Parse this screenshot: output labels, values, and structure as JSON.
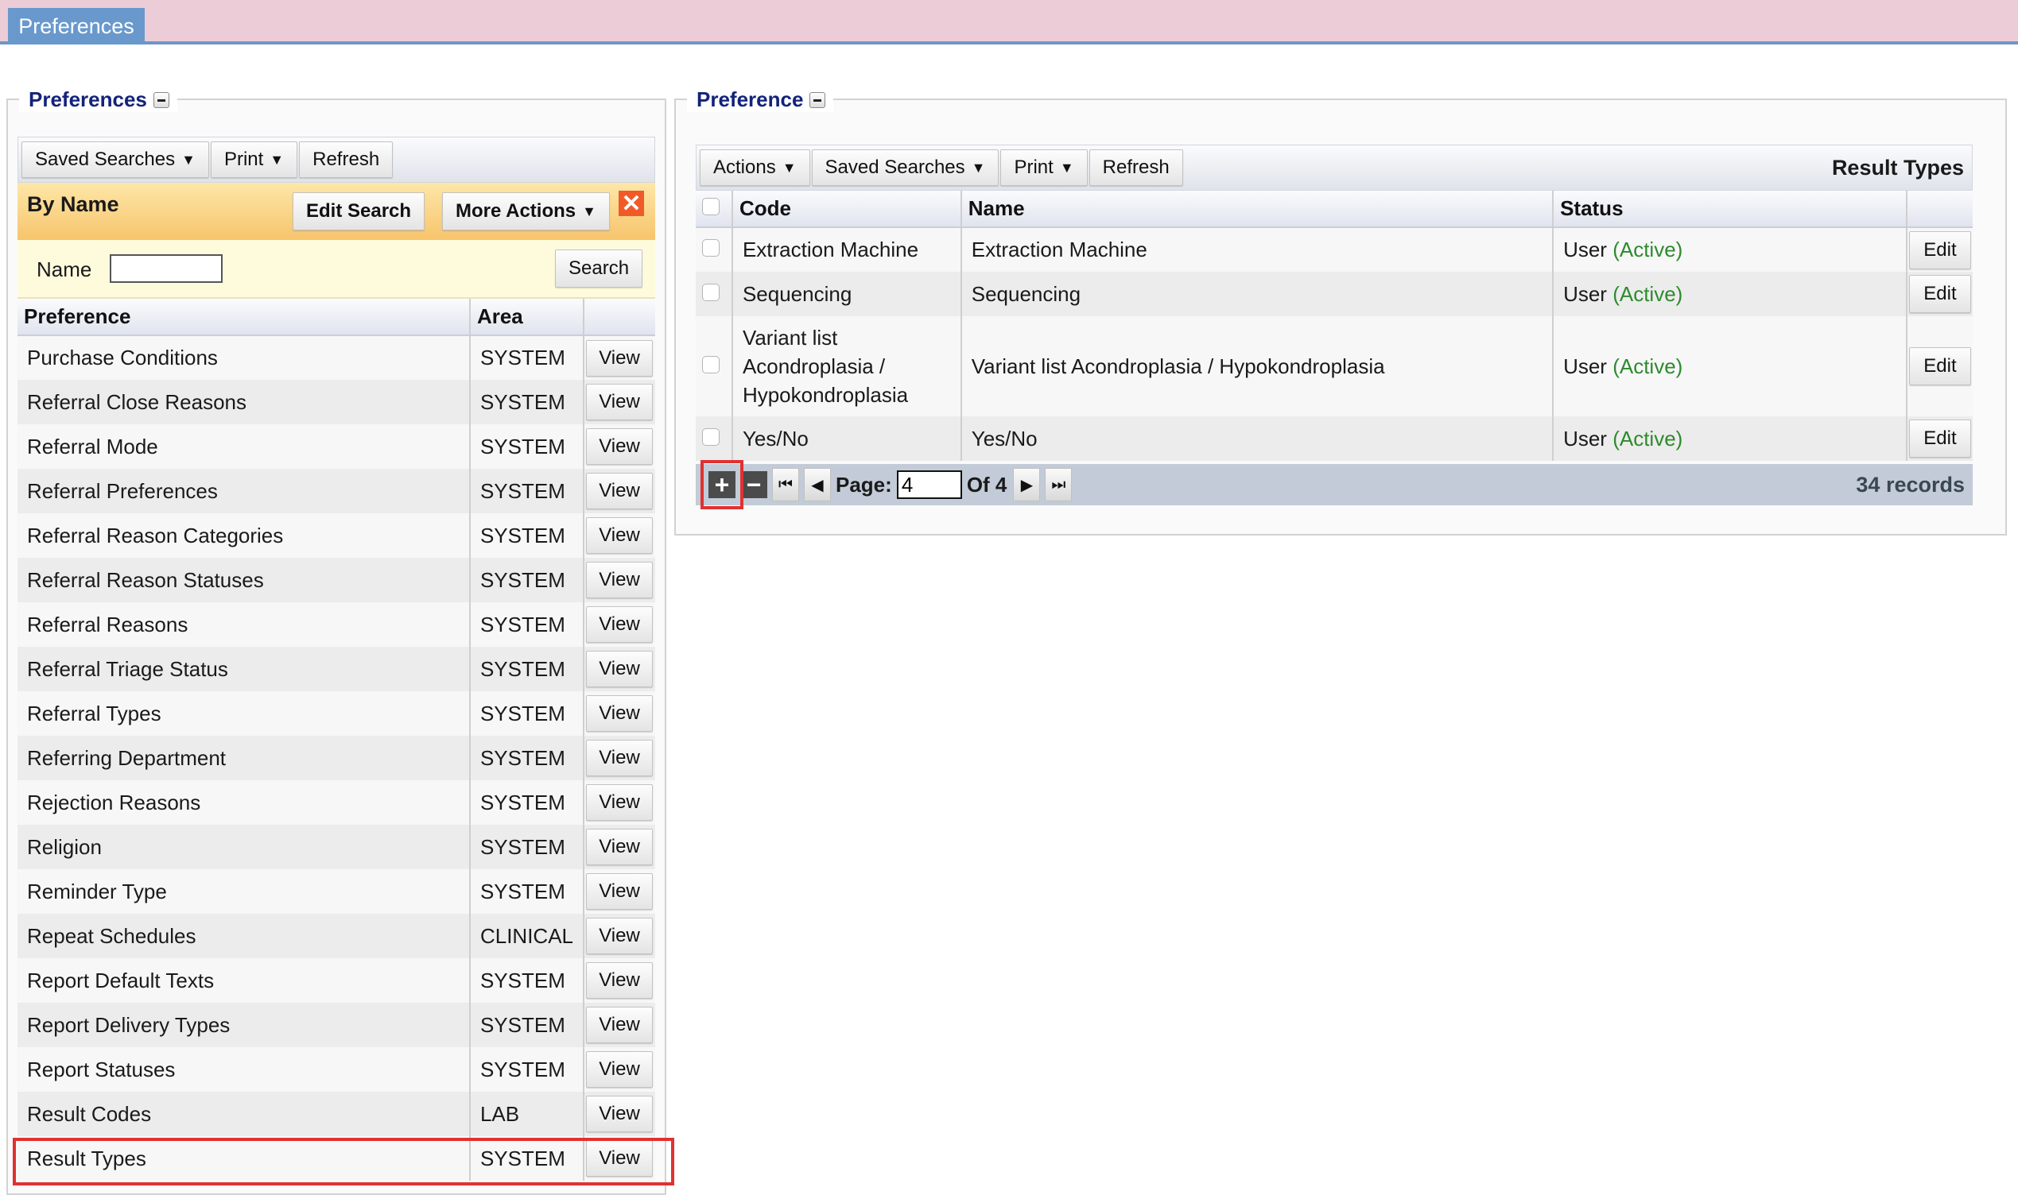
{
  "top_tab": "Preferences",
  "left_panel": {
    "legend": "Preferences",
    "toolbar": {
      "saved_searches": "Saved Searches",
      "print": "Print",
      "refresh": "Refresh"
    },
    "search_bar": {
      "title": "By Name",
      "edit_search": "Edit Search",
      "more_actions": "More Actions"
    },
    "filter": {
      "name_label": "Name",
      "name_value": "",
      "search_button": "Search"
    },
    "columns": [
      "Preference",
      "Area",
      ""
    ],
    "view_label": "View",
    "rows": [
      {
        "preference": "Purchase Conditions",
        "area": "SYSTEM"
      },
      {
        "preference": "Referral Close Reasons",
        "area": "SYSTEM"
      },
      {
        "preference": "Referral Mode",
        "area": "SYSTEM"
      },
      {
        "preference": "Referral Preferences",
        "area": "SYSTEM"
      },
      {
        "preference": "Referral Reason Categories",
        "area": "SYSTEM"
      },
      {
        "preference": "Referral Reason Statuses",
        "area": "SYSTEM"
      },
      {
        "preference": "Referral Reasons",
        "area": "SYSTEM"
      },
      {
        "preference": "Referral Triage Status",
        "area": "SYSTEM"
      },
      {
        "preference": "Referral Types",
        "area": "SYSTEM"
      },
      {
        "preference": "Referring Department",
        "area": "SYSTEM"
      },
      {
        "preference": "Rejection Reasons",
        "area": "SYSTEM"
      },
      {
        "preference": "Religion",
        "area": "SYSTEM"
      },
      {
        "preference": "Reminder Type",
        "area": "SYSTEM"
      },
      {
        "preference": "Repeat Schedules",
        "area": "CLINICAL"
      },
      {
        "preference": "Report Default Texts",
        "area": "SYSTEM"
      },
      {
        "preference": "Report Delivery Types",
        "area": "SYSTEM"
      },
      {
        "preference": "Report Statuses",
        "area": "SYSTEM"
      },
      {
        "preference": "Result Codes",
        "area": "LAB"
      },
      {
        "preference": "Result Types",
        "area": "SYSTEM"
      }
    ]
  },
  "right_panel": {
    "legend": "Preference",
    "toolbar": {
      "actions": "Actions",
      "saved_searches": "Saved Searches",
      "print": "Print",
      "refresh": "Refresh",
      "title": "Result Types"
    },
    "columns": [
      "Code",
      "Name",
      "Status",
      ""
    ],
    "edit_label": "Edit",
    "rows": [
      {
        "code": "Extraction Machine",
        "name": "Extraction Machine",
        "status_user": "User",
        "status_state": "(Active)"
      },
      {
        "code": "Sequencing",
        "name": "Sequencing",
        "status_user": "User",
        "status_state": "(Active)"
      },
      {
        "code": "Variant list Acondroplasia / Hypokondroplasia",
        "name": "Variant list Acondroplasia / Hypokondroplasia",
        "status_user": "User",
        "status_state": "(Active)"
      },
      {
        "code": "Yes/No",
        "name": "Yes/No",
        "status_user": "User",
        "status_state": "(Active)"
      }
    ],
    "pager": {
      "page_label": "Page:",
      "page_value": "4",
      "of_label": "Of 4",
      "records": "34 records"
    }
  },
  "colors": {
    "accent_tab": "#6999cc",
    "legend_text": "#13237a",
    "active_status": "#2d8a2d",
    "highlight": "#e03131",
    "topbar": "#ecccd6"
  }
}
